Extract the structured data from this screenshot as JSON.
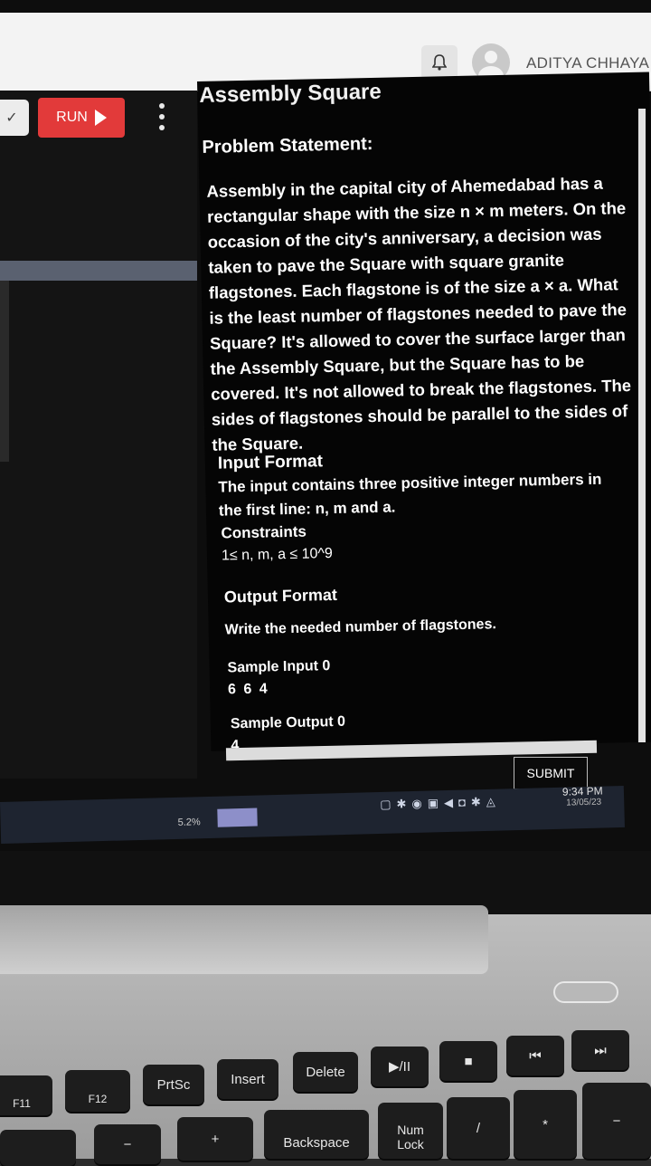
{
  "topbar": {
    "username": "ADITYA CHHAYA",
    "bell_icon": "bell-icon"
  },
  "editor": {
    "run_label": "RUN"
  },
  "problem": {
    "title": "Assembly Square",
    "statement_heading": "Problem Statement:",
    "description": "Assembly in the capital city of Ahemedabad has a rectangular shape with the size n × m meters. On the occasion of the city's anniversary, a decision was taken to pave the Square with square granite flagstones. Each flagstone is of the size a × a. What is the least number of flagstones needed to pave the Square? It's allowed to cover the surface larger than the Assembly Square, but the Square has to be covered. It's not allowed to break the flagstones. The sides of flagstones should be parallel to the sides of the Square.",
    "input_heading": "Input Format",
    "input_text": "The input contains three positive integer numbers in the first line: n, m and a.",
    "constraints_heading": "Constraints",
    "constraints_text": "1≤ n, m, a ≤ 10^9",
    "output_heading": "Output Format",
    "output_text": "Write the needed number of flagstones.",
    "sample_input_heading": "Sample Input 0",
    "sample_input_value": "6 6 4",
    "sample_output_heading": "Sample Output 0",
    "sample_output_value": "4"
  },
  "submit_label": "SUBMIT",
  "taskbar": {
    "cpu": "5.2%",
    "time": "9:34 PM",
    "date": "13/05/23"
  },
  "keyboard": {
    "f11": "F11",
    "f12": "F12",
    "prtsc": "PrtSc",
    "insert": "Insert",
    "delete": "Delete",
    "playpause": "▶/II",
    "stop": "■",
    "prev": "⏮",
    "next": "⏭",
    "backspace": "Backspace",
    "numlock": "Num Lock",
    "slash": "/",
    "star": "*",
    "minus": "−",
    "plus": "+"
  }
}
